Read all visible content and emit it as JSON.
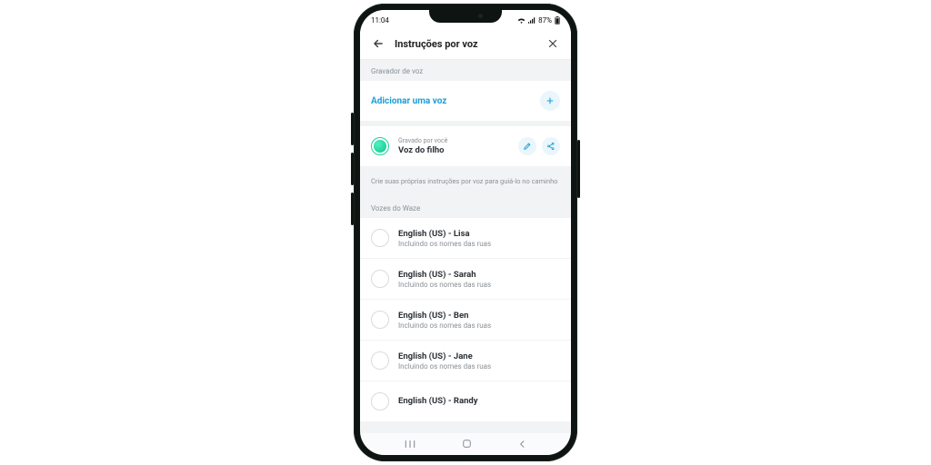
{
  "status": {
    "time": "11:04",
    "battery": "87%"
  },
  "header": {
    "title": "Instruções por voz"
  },
  "recorder": {
    "section_label": "Gravador de voz",
    "add_label": "Adicionar uma voz",
    "custom": {
      "overline": "Gravado por você",
      "name": "Voz do filho"
    },
    "hint": "Crie suas próprias instruções por voz para guiá-lo no caminho"
  },
  "waze": {
    "section_label": "Vozes do Waze",
    "voices": [
      {
        "name": "English (US) - Lisa",
        "sub": "Incluindo os nomes das ruas"
      },
      {
        "name": "English (US) - Sarah",
        "sub": "Incluindo os nomes das ruas"
      },
      {
        "name": "English (US) - Ben",
        "sub": "Incluindo os nomes das ruas"
      },
      {
        "name": "English (US) - Jane",
        "sub": "Incluindo os nomes das ruas"
      },
      {
        "name": "English (US) - Randy",
        "sub": ""
      }
    ]
  }
}
